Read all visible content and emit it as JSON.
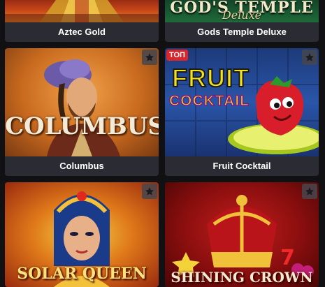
{
  "games": [
    {
      "title": "Aztec Gold",
      "logo": "",
      "favorite_icon": "star-icon"
    },
    {
      "title": "Gods Temple Deluxe",
      "logo": "GOD'S TEMPLE",
      "logo_sub": "Deluxe",
      "favorite_icon": "star-icon"
    },
    {
      "title": "Columbus",
      "logo": "COLUMBUS",
      "favorite_icon": "star-icon"
    },
    {
      "title": "Fruit Cocktail",
      "badge": "ТОП",
      "logo_line1": "FRUIT",
      "logo_line2": "COCKTAIL",
      "favorite_icon": "star-icon"
    },
    {
      "title": "Solar Queen",
      "logo": "SOLAR QUEEN",
      "favorite_icon": "star-icon"
    },
    {
      "title": "Shining Crown",
      "logo": "SHINING CROWN",
      "favorite_icon": "star-icon"
    }
  ],
  "colors": {
    "background": "#111114",
    "caption_bg": "#2b2c33",
    "badge_red": "#d8262c"
  }
}
